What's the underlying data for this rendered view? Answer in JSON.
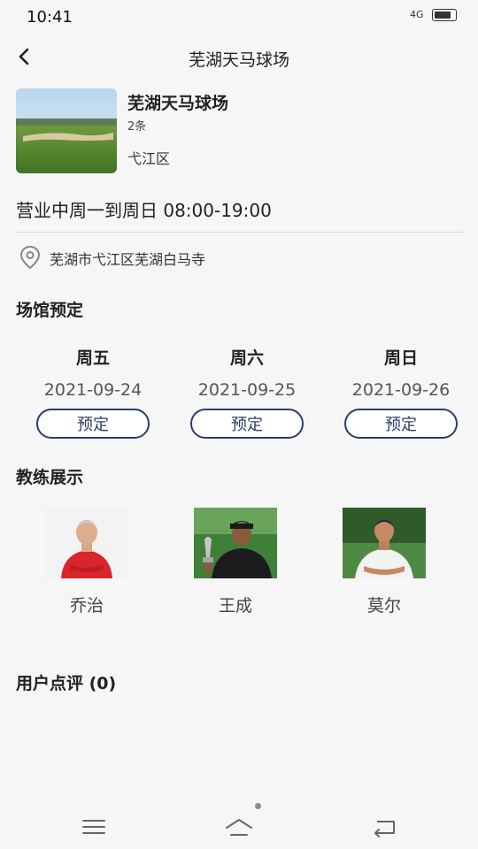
{
  "status_bar": {
    "time": "10:41",
    "indicators": "4G"
  },
  "nav": {
    "title": "芜湖天马球场",
    "back_icon": "chevron-left-icon"
  },
  "venue": {
    "name": "芜湖天马球场",
    "count": "2条",
    "district": "弋江区",
    "hours": "营业中周一到周日 08:00-19:00",
    "address": "芜湖市弋江区芜湖白马寺"
  },
  "booking": {
    "title": "场馆预定",
    "days": [
      {
        "weekday": "周五",
        "date": "2021-09-24",
        "button": "预定"
      },
      {
        "weekday": "周六",
        "date": "2021-09-25",
        "button": "预定"
      },
      {
        "weekday": "周日",
        "date": "2021-09-26",
        "button": "预定"
      }
    ]
  },
  "coaches": {
    "title": "教练展示",
    "items": [
      {
        "name": "乔治"
      },
      {
        "name": "王成"
      },
      {
        "name": "莫尔"
      }
    ]
  },
  "reviews": {
    "title": "用户点评 (0)"
  },
  "colors": {
    "accent": "#2c3e66",
    "background": "#f6f6f7"
  }
}
